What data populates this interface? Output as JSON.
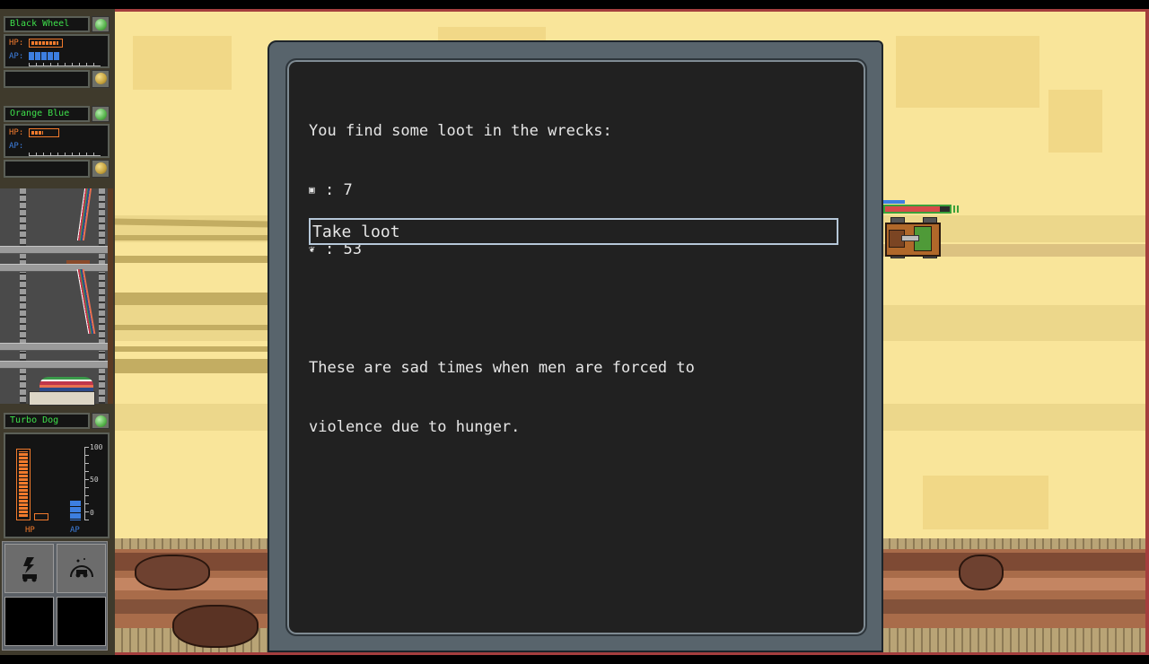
{
  "hud": {
    "party": [
      {
        "name": "Black Wheel",
        "hp_fraction": 0.9,
        "ap_segments": 5,
        "ap_max_segments": 11,
        "status": "green"
      },
      {
        "name": "Orange Blue",
        "hp_fraction": 0.4,
        "ap_segments": 0,
        "ap_max_segments": 11,
        "status": "green"
      }
    ],
    "labels": {
      "hp": "HP:",
      "ap": "AP:"
    },
    "vehicle": {
      "name": "Turbo Dog",
      "status": "green",
      "hp_percent": 100,
      "ap_percent": 20,
      "scale_ticks": [
        "100",
        "50",
        "0"
      ],
      "hp_label": "HP",
      "ap_label": "AP"
    },
    "abilities": [
      {
        "name": "boost-icon",
        "enabled": true
      },
      {
        "name": "shield-scan-icon",
        "enabled": true
      },
      {
        "name": "empty-slot",
        "enabled": false
      },
      {
        "name": "empty-slot",
        "enabled": false
      }
    ]
  },
  "dialog": {
    "intro": "You find some loot in the wrecks:",
    "loot": [
      {
        "icon": "fuel-can-icon",
        "glyph": "▣",
        "text": ": 7"
      },
      {
        "icon": "food-icon",
        "glyph": "❦",
        "text": ": 53"
      }
    ],
    "flavor_line1": "These are sad times when men are forced to",
    "flavor_line2": "violence due to hunger.",
    "options": [
      {
        "label": "Take loot"
      }
    ]
  },
  "colors": {
    "name_text": "#3ee04b",
    "hp": "#f07a2c",
    "ap": "#3d7fe0",
    "sand": "#f9e59a",
    "dialog_bg": "#212121"
  }
}
